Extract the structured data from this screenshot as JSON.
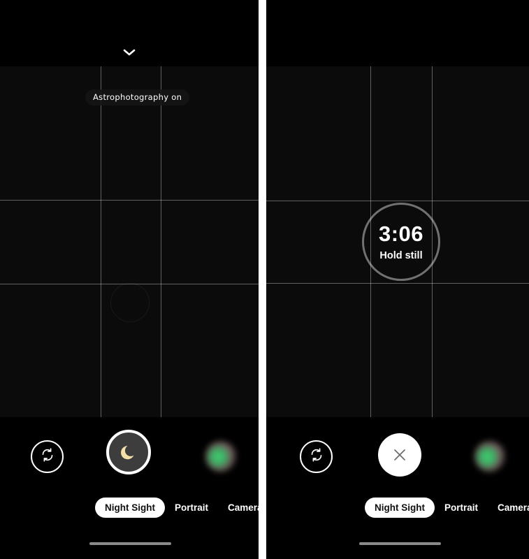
{
  "colors": {
    "panel_background": "#000000",
    "viewfinder_background": "#0b0b0b",
    "gutter": "#ffffff",
    "grid_line": "rgba(255,255,255,0.35)",
    "accent_white": "#ffffff",
    "shutter_night_fill": "#3d3d3d",
    "moon_glyph": "#f2e0a8",
    "timer_ring": "rgba(255,255,255,0.42)",
    "home_indicator": "#8a8a8a",
    "close_glyph": "#6b6b6b"
  },
  "panels": [
    {
      "id": "left",
      "name": "astrophotography-ready",
      "topbar": {
        "expand_icon": "chevron-down-icon"
      },
      "viewfinder": {
        "grid": "rule-of-thirds",
        "badge": "Astrophotography on",
        "focus_ring": "focus-ring"
      },
      "controls": {
        "flip_icon": "camera-flip-icon",
        "shutter": {
          "type": "night-sight",
          "icon": "crescent-moon-icon"
        },
        "thumbnail": "gallery-thumbnail"
      },
      "modes": [
        {
          "label": "Night Sight",
          "active": true
        },
        {
          "label": "Portrait",
          "active": false
        },
        {
          "label": "Camera",
          "active": false
        }
      ]
    },
    {
      "id": "right",
      "name": "astrophotography-capturing",
      "topbar": {
        "expand_icon": ""
      },
      "viewfinder": {
        "grid": "rule-of-thirds",
        "timer": {
          "value": "3:06",
          "hint": "Hold still"
        }
      },
      "controls": {
        "flip_icon": "camera-flip-icon",
        "shutter": {
          "type": "cancel",
          "icon": "close-icon"
        },
        "thumbnail": "gallery-thumbnail"
      },
      "modes": [
        {
          "label": "Night Sight",
          "active": true
        },
        {
          "label": "Portrait",
          "active": false
        },
        {
          "label": "Camera",
          "active": false
        }
      ]
    }
  ]
}
